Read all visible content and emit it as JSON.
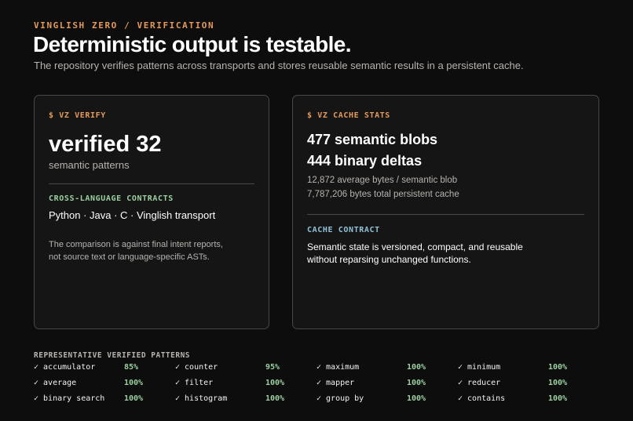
{
  "header": {
    "eyebrow": "VINGLISH ZERO / VERIFICATION",
    "title": "Deterministic output is testable.",
    "subtitle": "The repository verifies patterns across transports and stores reusable semantic results in a persistent cache."
  },
  "verify_card": {
    "command": "$ VZ VERIFY",
    "stat": "verified 32",
    "stat_sub": "semantic patterns",
    "contracts_label": "CROSS-LANGUAGE CONTRACTS",
    "languages": "Python · Java · C · Vinglish transport",
    "note_line1": "The comparison is against final intent reports,",
    "note_line2": "not source text or language-specific ASTs."
  },
  "cache_card": {
    "command": "$ VZ CACHE STATS",
    "blobs": "477 semantic blobs",
    "deltas": "444 binary deltas",
    "avg_bytes": "12,872 average bytes / semantic blob",
    "total_bytes": "7,787,206 bytes total persistent cache",
    "contract_label": "CACHE CONTRACT",
    "contract_line1": "Semantic state is versioned, compact, and reusable",
    "contract_line2": "without reparsing unchanged functions."
  },
  "patterns": {
    "heading": "REPRESENTATIVE VERIFIED PATTERNS",
    "items": [
      {
        "name": "✓ accumulator",
        "pct": "85%"
      },
      {
        "name": "✓ counter",
        "pct": "95%"
      },
      {
        "name": "✓ maximum",
        "pct": "100%"
      },
      {
        "name": "✓ minimum",
        "pct": "100%"
      },
      {
        "name": "✓ average",
        "pct": "100%"
      },
      {
        "name": "✓ filter",
        "pct": "100%"
      },
      {
        "name": "✓ mapper",
        "pct": "100%"
      },
      {
        "name": "✓ reducer",
        "pct": "100%"
      },
      {
        "name": "✓ binary search",
        "pct": "100%"
      },
      {
        "name": "✓ histogram",
        "pct": "100%"
      },
      {
        "name": "✓ group by",
        "pct": "100%"
      },
      {
        "name": "✓ contains",
        "pct": "100%"
      }
    ]
  }
}
